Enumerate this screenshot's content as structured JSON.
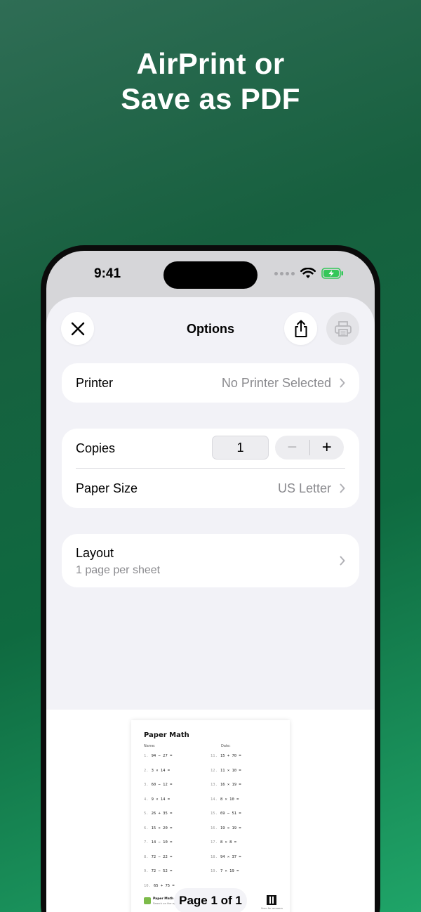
{
  "headline": {
    "line1": "AirPrint or",
    "line2": "Save as PDF"
  },
  "status_bar": {
    "time": "9:41"
  },
  "sheet": {
    "title": "Options",
    "close_icon": "close-icon",
    "share_icon": "share-icon",
    "print_icon": "printer-icon"
  },
  "printer": {
    "label": "Printer",
    "value": "No Printer Selected"
  },
  "copies": {
    "label": "Copies",
    "value": "1",
    "decrement": "−",
    "increment": "+"
  },
  "paper_size": {
    "label": "Paper Size",
    "value": "US Letter"
  },
  "layout": {
    "label": "Layout",
    "value": "1 page per sheet"
  },
  "preview": {
    "title": "Paper Math",
    "name_label": "Name:",
    "date_label": "Date:",
    "left_problems": [
      {
        "n": "1.",
        "q": "94 − 27 ="
      },
      {
        "n": "2.",
        "q": "3 × 14 ="
      },
      {
        "n": "3.",
        "q": "60 − 12 ="
      },
      {
        "n": "4.",
        "q": "9 × 14 ="
      },
      {
        "n": "5.",
        "q": "26 + 35 ="
      },
      {
        "n": "6.",
        "q": "15 × 20 ="
      },
      {
        "n": "7.",
        "q": "14 − 10 ="
      },
      {
        "n": "8.",
        "q": "72 − 22 ="
      },
      {
        "n": "9.",
        "q": "72 − 52 ="
      },
      {
        "n": "10.",
        "q": "65 + 75 ="
      }
    ],
    "right_problems": [
      {
        "n": "11.",
        "q": "15 + 70 ="
      },
      {
        "n": "12.",
        "q": "11 × 10 ="
      },
      {
        "n": "13.",
        "q": "16 × 19 ="
      },
      {
        "n": "14.",
        "q": "8 × 10 ="
      },
      {
        "n": "15.",
        "q": "69 − 51 ="
      },
      {
        "n": "16.",
        "q": "19 × 19 ="
      },
      {
        "n": "17.",
        "q": "8 × 8 ="
      },
      {
        "n": "18.",
        "q": "94 × 37 ="
      },
      {
        "n": "19.",
        "q": "7 × 19 ="
      }
    ],
    "footer_title": "Paper Math",
    "footer_subtitle": "Search on the ap...",
    "qr_caption": "Scan for answers",
    "page_label": "Page 1 of 1"
  }
}
